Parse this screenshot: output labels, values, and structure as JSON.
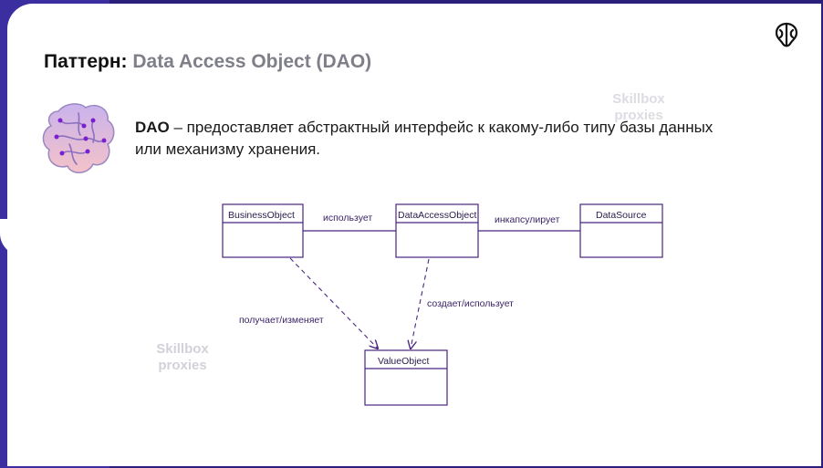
{
  "slide": {
    "title_prefix": "Паттерн: ",
    "title_accent": "Data Access Object (DAO)",
    "desc_bold": "DAO",
    "desc_text": " – предоставляет абстрактный интерфейс к какому-либо типу базы данных или механизму хранения.",
    "watermark_top": [
      "Skillbox",
      "proxies"
    ],
    "watermark_bottom": [
      "Skillbox",
      "proxies"
    ]
  },
  "diagram": {
    "classes": {
      "business_object": "BusinessObject",
      "data_access_object": "DataAccessObject",
      "data_source": "DataSource",
      "value_object": "ValueObject"
    },
    "relations": {
      "uses": "использует",
      "encapsulates": "инкапсулирует",
      "gets_changes": "получает/изменяет",
      "creates_uses": "создает/использует"
    }
  },
  "colors": {
    "accent": "#4a2580",
    "background": "#2a1f7a"
  },
  "icons": [
    "skillbox-logo-icon",
    "brain-icon"
  ]
}
